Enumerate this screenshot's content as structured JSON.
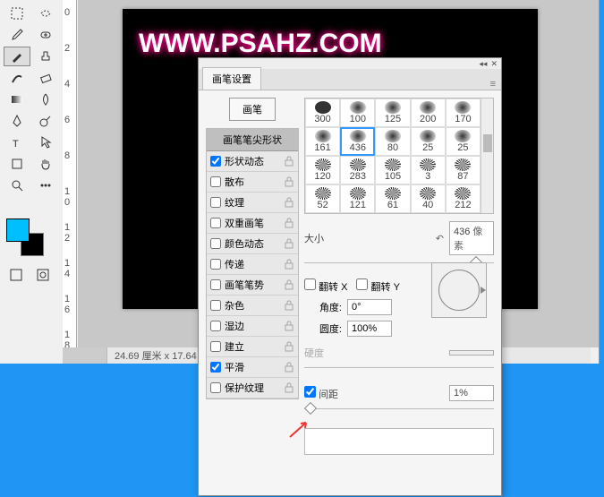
{
  "canvas_text": "WWW.PSAHZ.COM",
  "status": {
    "dims": "24.69 厘米 x 17.64"
  },
  "ruler_marks": [
    "0",
    "2",
    "4",
    "6",
    "8",
    "1\n0",
    "1\n2",
    "1\n4",
    "1\n6",
    "1\n8"
  ],
  "panel": {
    "tab": "画笔设置",
    "brush_btn": "画笔",
    "tip_header": "画笔笔尖形状",
    "options": [
      {
        "label": "形状动态",
        "checked": true
      },
      {
        "label": "散布",
        "checked": false
      },
      {
        "label": "纹理",
        "checked": false
      },
      {
        "label": "双重画笔",
        "checked": false
      },
      {
        "label": "颜色动态",
        "checked": false
      },
      {
        "label": "传递",
        "checked": false
      },
      {
        "label": "画笔笔势",
        "checked": false
      },
      {
        "label": "杂色",
        "checked": false
      },
      {
        "label": "湿边",
        "checked": false
      },
      {
        "label": "建立",
        "checked": false
      },
      {
        "label": "平滑",
        "checked": true
      },
      {
        "label": "保护纹理",
        "checked": false
      }
    ],
    "brushes": [
      [
        "300",
        "100",
        "125",
        "200",
        "170"
      ],
      [
        "161",
        "436",
        "80",
        "25",
        "25"
      ],
      [
        "120",
        "283",
        "105",
        "3",
        "87"
      ],
      [
        "52",
        "121",
        "61",
        "40",
        "212"
      ],
      [
        "",
        "",
        "",
        "",
        ""
      ]
    ],
    "selected_brush": 6,
    "size_label": "大小",
    "size_value": "436",
    "size_unit": "像素",
    "flip_x": "翻转 X",
    "flip_y": "翻转 Y",
    "angle_label": "角度:",
    "angle_value": "0°",
    "round_label": "圆度:",
    "round_value": "100%",
    "hardness_label": "硬度",
    "spacing_label": "间距",
    "spacing_value": "1%"
  }
}
